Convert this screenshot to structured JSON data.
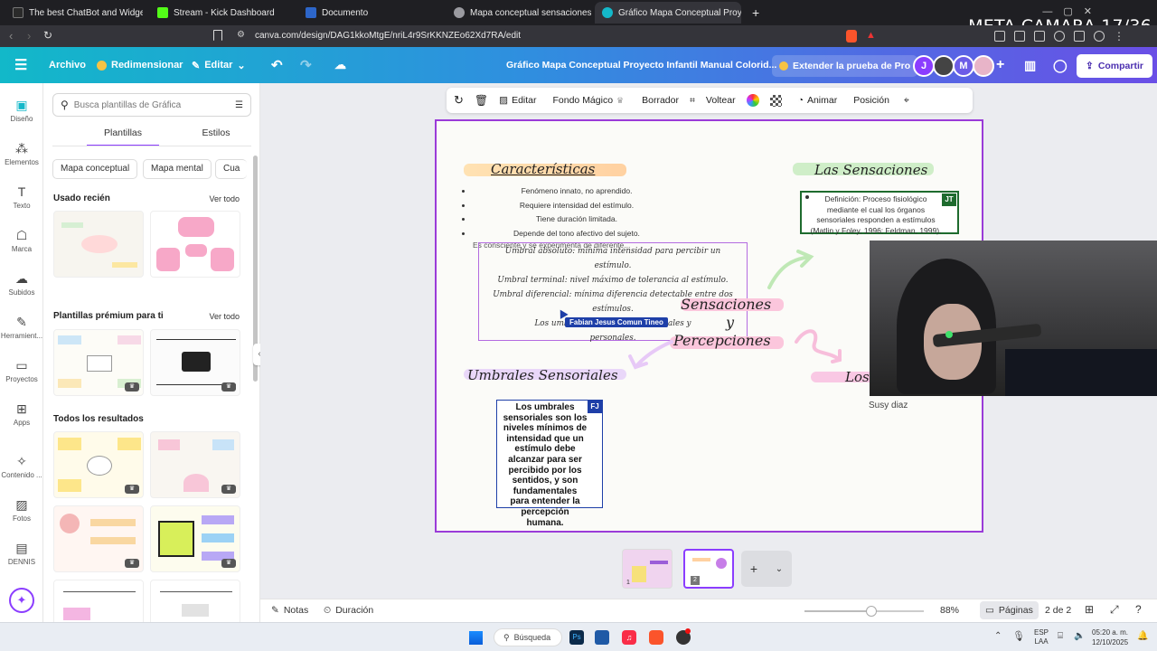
{
  "browser": {
    "tabs": [
      {
        "label": "The best ChatBot and Widgets f",
        "color": "#222"
      },
      {
        "label": "Stream - Kick Dashboard",
        "color": "#53fc18"
      },
      {
        "label": "Documento",
        "color": "#2d66c9"
      },
      {
        "label": "Mapa conceptual sensaciones",
        "color": "#9a9aa0"
      },
      {
        "label": "Gráfico Mapa Conceptual Proyec",
        "color": "#14b8c9"
      }
    ],
    "new_tab": "+",
    "url": "canva.com/design/DAG1kkoMtgE/nriL4r9SrKKNZEo62Xd7RA/edit",
    "overlay_text": "META CAMARA 17/36"
  },
  "header": {
    "archivo": "Archivo",
    "redimensionar": "Redimensionar",
    "editar": "Editar",
    "doc_title": "Gráfico Mapa Conceptual Proyecto Infantil Manual Colorid...",
    "trial": "Extender la prueba de Pro",
    "avatars": [
      "J",
      "",
      "M",
      ""
    ],
    "plus": "+",
    "share": "Compartir"
  },
  "rail": [
    {
      "label": "Diseño",
      "icon": "design-icon"
    },
    {
      "label": "Elementos",
      "icon": "elements-icon"
    },
    {
      "label": "Texto",
      "icon": "text-icon"
    },
    {
      "label": "Marca",
      "icon": "brand-icon"
    },
    {
      "label": "Subidos",
      "icon": "upload-icon"
    },
    {
      "label": "Herramient...",
      "icon": "tools-icon"
    },
    {
      "label": "Proyectos",
      "icon": "folder-icon"
    },
    {
      "label": "Apps",
      "icon": "apps-icon"
    },
    {
      "label": "Contenido ...",
      "icon": "content-icon"
    },
    {
      "label": "Fotos",
      "icon": "photo-icon"
    },
    {
      "label": "DENNIS",
      "icon": "dennis-icon"
    }
  ],
  "panel": {
    "search_placeholder": "Busca plantillas de Gráfica",
    "tab_templates": "Plantillas",
    "tab_styles": "Estilos",
    "chips": [
      "Mapa conceptual",
      "Mapa mental",
      "Cua"
    ],
    "recent": "Usado recién",
    "premium": "Plantillas prémium para ti",
    "see_all": "Ver todo",
    "all_results": "Todos los resultados"
  },
  "toolbar": {
    "edit": "Editar",
    "magic_bg": "Fondo Mágico",
    "eraser": "Borrador",
    "flip": "Voltear",
    "animate": "Animar",
    "position": "Posición"
  },
  "canvas": {
    "title_caracteristicas": "Características",
    "caracteristicas": [
      "Fenómeno innato, no aprendido.",
      "Requiere intensidad del estímulo.",
      "Tiene duración limitada.",
      "Depende del tono afectivo del sujeto.",
      "Es consciente y se experimenta de diferente..."
    ],
    "umbral_lines": [
      "Umbral absoluto: mínima intensidad para percibir un",
      "estímulo.",
      "Umbral terminal: nivel máximo de tolerancia al estímulo.",
      "Umbral diferencial: mínima diferencia detectable entre dos",
      "estímulos.",
      "Los umbrales var... ...ógicos, sociales y",
      "personales."
    ],
    "title_sensaciones": "Las Sensaciones",
    "definicion": "Definición: Proceso fisiológico mediante el cual los órganos sensoriales responden a estímulos (Matlin y Foley, 1996; Feldman, 1999).",
    "badge_jt": "JT",
    "center_1": "Sensaciones",
    "center_y": "y",
    "center_2": "Percepciones",
    "title_umbrales": "Umbrales Sensoriales",
    "umbrales_box": "Los umbrales sensoriales son los niveles mínimos de intensidad que un estímulo debe alcanzar para ser percibido por los sentidos, y son fundamentales para entender la percepción humana.",
    "badge_fj": "FJ",
    "cursor_name": "Fabian Jesus Comun Tineo",
    "partial_los": "Los",
    "webcam_name": "Susy diaz"
  },
  "status": {
    "notes": "Notas",
    "duration": "Duración",
    "zoom": "88%",
    "pages": "Páginas",
    "page_count": "2 de 2",
    "page_number": "2"
  },
  "taskbar": {
    "search": "Búsqueda",
    "lang1": "ESP",
    "lang2": "LAA",
    "time": "05:20 a. m.",
    "date": "12/10/2025"
  },
  "colors": {
    "accent": "#8b3dff",
    "header_start": "#12b8c9",
    "header_end": "#6a4fe6",
    "page_border": "#9a3bd8",
    "box_border": "#1e6b2e",
    "fj_badge": "#1e3fa8"
  }
}
